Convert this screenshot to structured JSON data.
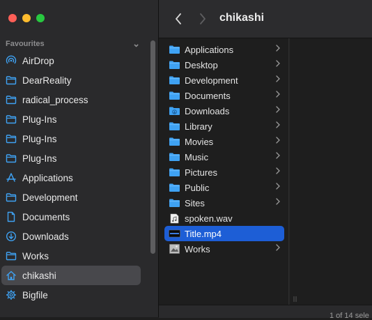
{
  "window": {
    "title": "chikashi"
  },
  "colors": {
    "close": "#fe5f57",
    "minimize": "#febc2e",
    "zoom": "#28c840",
    "accent": "#1d5ed6",
    "folder": "#3fa2f3"
  },
  "sidebar": {
    "section_label": "Favourites",
    "items": [
      {
        "label": "AirDrop",
        "icon": "airdrop-icon"
      },
      {
        "label": "DearReality",
        "icon": "folder-icon"
      },
      {
        "label": "radical_process",
        "icon": "folder-icon"
      },
      {
        "label": "Plug-Ins",
        "icon": "folder-icon"
      },
      {
        "label": "Plug-Ins",
        "icon": "folder-icon"
      },
      {
        "label": "Plug-Ins",
        "icon": "folder-icon"
      },
      {
        "label": "Applications",
        "icon": "applications-icon"
      },
      {
        "label": "Development",
        "icon": "folder-icon"
      },
      {
        "label": "Documents",
        "icon": "document-icon"
      },
      {
        "label": "Downloads",
        "icon": "download-icon"
      },
      {
        "label": "Works",
        "icon": "folder-icon"
      },
      {
        "label": "chikashi",
        "icon": "home-icon",
        "selected": true
      },
      {
        "label": "Bigfile",
        "icon": "gear-icon"
      }
    ]
  },
  "column": {
    "items": [
      {
        "label": "Applications",
        "icon": "folder-icon",
        "has_children": true
      },
      {
        "label": "Desktop",
        "icon": "folder-icon",
        "has_children": true
      },
      {
        "label": "Development",
        "icon": "folder-icon",
        "has_children": true
      },
      {
        "label": "Documents",
        "icon": "folder-icon",
        "has_children": true
      },
      {
        "label": "Downloads",
        "icon": "download-folder-icon",
        "has_children": true
      },
      {
        "label": "Library",
        "icon": "folder-icon",
        "has_children": true
      },
      {
        "label": "Movies",
        "icon": "folder-icon",
        "has_children": true
      },
      {
        "label": "Music",
        "icon": "folder-icon",
        "has_children": true
      },
      {
        "label": "Pictures",
        "icon": "folder-icon",
        "has_children": true
      },
      {
        "label": "Public",
        "icon": "folder-icon",
        "has_children": true
      },
      {
        "label": "Sites",
        "icon": "folder-icon",
        "has_children": true
      },
      {
        "label": "spoken.wav",
        "icon": "audio-file-icon",
        "has_children": false
      },
      {
        "label": "Title.mp4",
        "icon": "video-file-icon",
        "has_children": false,
        "selected": true
      },
      {
        "label": "Works",
        "icon": "image-file-icon",
        "has_children": true
      }
    ]
  },
  "status": {
    "text": "1 of 14 sele"
  }
}
